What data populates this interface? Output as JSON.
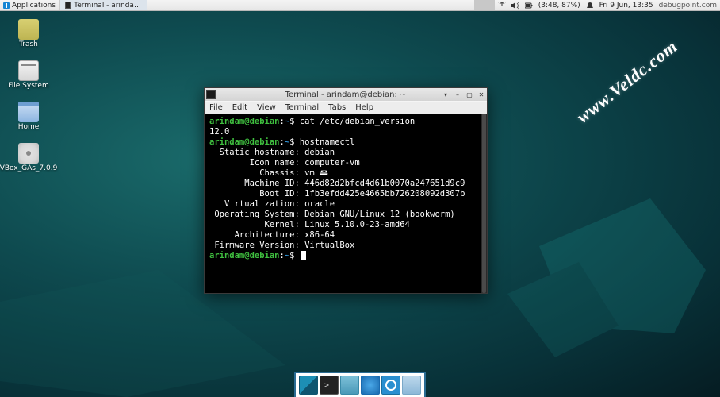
{
  "panel": {
    "applications_label": "Applications",
    "task_label": "Terminal - arindam@de...",
    "battery_text": "(3:48, 87%)",
    "datetime": "Fri   9 Jun, 13:35",
    "brand": "debugpoint.com"
  },
  "desktop": {
    "icons": [
      {
        "name": "trash",
        "label": "Trash"
      },
      {
        "name": "filesystem",
        "label": "File System"
      },
      {
        "name": "home",
        "label": "Home"
      },
      {
        "name": "vbox",
        "label": "VBox_GAs_7.0.9"
      }
    ]
  },
  "watermark": "www.Veldc.com",
  "terminal": {
    "title": "Terminal - arindam@debian: ~",
    "menus": [
      "File",
      "Edit",
      "View",
      "Terminal",
      "Tabs",
      "Help"
    ],
    "prompt_user": "arindam@debian",
    "prompt_path": "~",
    "prompt_symbol": "$",
    "cmd1": "cat /etc/debian_version",
    "out_version": "12.0",
    "cmd2": "hostnamectl",
    "hostnamectl": {
      "Static hostname": "debian",
      "Icon name": "computer-vm",
      "Chassis": "vm 🖴",
      "Machine ID": "446d82d2bfcd4d61b0070a247651d9c9",
      "Boot ID": "1fb3efdd425e4665bb726208092d307b",
      "Virtualization": "oracle",
      "Operating System": "Debian GNU/Linux 12 (bookworm)",
      "Kernel": "Linux 5.10.0-23-amd64",
      "Architecture": "x86-64",
      "Firmware Version": "VirtualBox"
    }
  },
  "dock": {
    "items": [
      "show-desktop",
      "terminal",
      "file-manager",
      "web-browser",
      "app-finder",
      "directory"
    ]
  }
}
